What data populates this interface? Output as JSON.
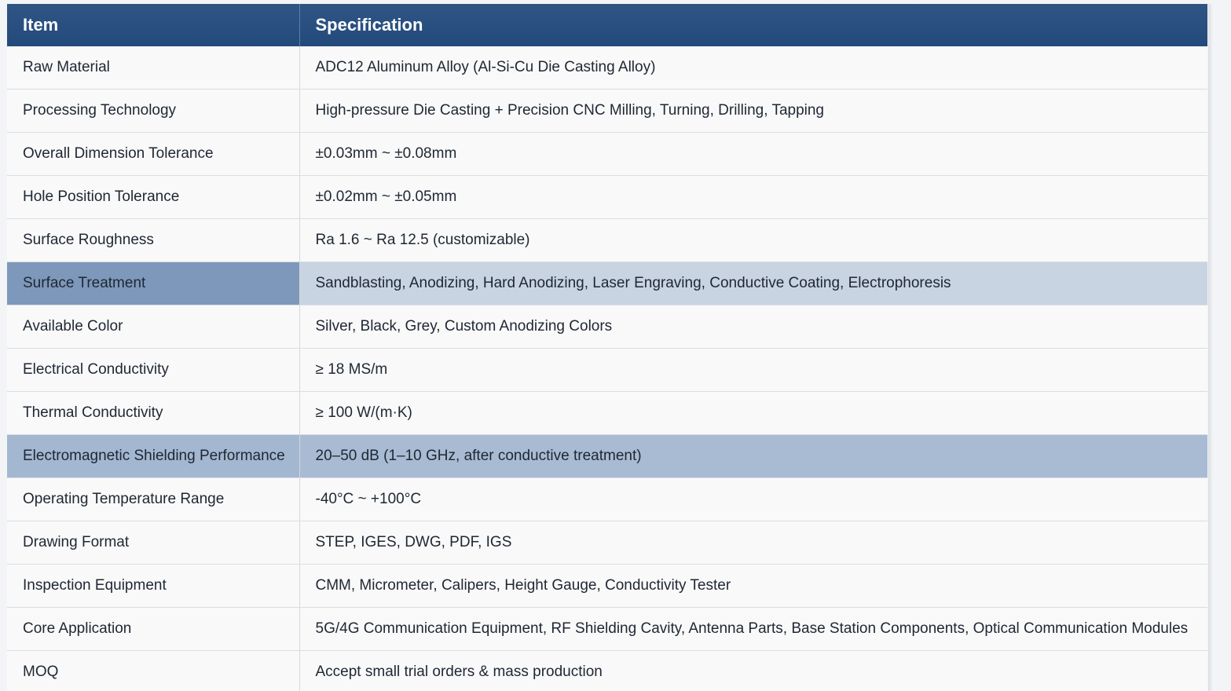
{
  "table": {
    "headers": {
      "item": "Item",
      "specification": "Specification"
    },
    "rows": [
      {
        "item": "Raw Material",
        "spec": "ADC12 Aluminum Alloy (Al-Si-Cu Die Casting Alloy)"
      },
      {
        "item": "Processing Technology",
        "spec": "High-pressure Die Casting + Precision CNC Milling, Turning, Drilling, Tapping"
      },
      {
        "item": "Overall Dimension Tolerance",
        "spec": "±0.03mm ~ ±0.08mm"
      },
      {
        "item": "Hole Position Tolerance",
        "spec": "±0.02mm ~ ±0.05mm"
      },
      {
        "item": "Surface Roughness",
        "spec": "Ra 1.6 ~ Ra 12.5 (customizable)"
      },
      {
        "item": "Surface Treatment",
        "spec": "Sandblasting, Anodizing, Hard Anodizing, Laser Engraving, Conductive Coating, Electrophoresis"
      },
      {
        "item": "Available Color",
        "spec": "Silver, Black, Grey, Custom Anodizing Colors"
      },
      {
        "item": "Electrical Conductivity",
        "spec": "≥ 18 MS/m"
      },
      {
        "item": "Thermal Conductivity",
        "spec": "≥ 100 W/(m·K)"
      },
      {
        "item": "Electromagnetic Shielding Performance",
        "spec": "20–50 dB (1–10 GHz, after conductive treatment)"
      },
      {
        "item": "Operating Temperature Range",
        "spec": "-40°C ~ +100°C"
      },
      {
        "item": "Drawing Format",
        "spec": "STEP, IGES, DWG, PDF, IGS"
      },
      {
        "item": "Inspection Equipment",
        "spec": "CMM, Micrometer, Calipers, Height Gauge, Conductivity Tester"
      },
      {
        "item": "Core Application",
        "spec": "5G/4G Communication Equipment, RF Shielding Cavity, Antenna Parts, Base Station Components, Optical Communication Modules"
      },
      {
        "item": "MOQ",
        "spec": "Accept small trial orders & mass production"
      }
    ]
  },
  "colors": {
    "header_bg": "#2a5080",
    "highlight_row": "#c9d4e2",
    "highlight_row_strong": "#a8bbd3"
  }
}
